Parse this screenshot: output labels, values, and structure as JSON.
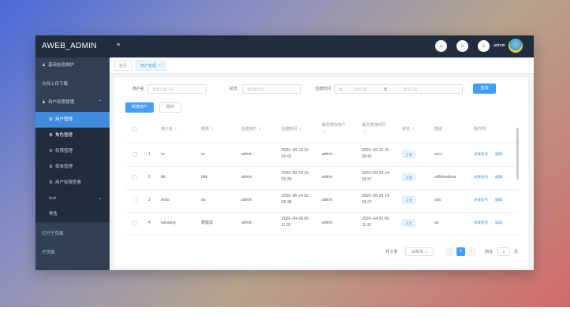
{
  "app": {
    "title": "AWEB_ADMIN",
    "menu_toggle": "≡",
    "user": "admin"
  },
  "colors": {
    "topbar": "#1f2d3d",
    "sidebar": "#304156",
    "accent": "#409eff"
  },
  "topbar_icons": [
    "home-icon",
    "home-icon",
    "home-icon"
  ],
  "sidebar": {
    "items": [
      {
        "label": "基础信息维护",
        "icon": "user-icon"
      },
      {
        "label": "文档上传下载"
      },
      {
        "label": "用户权限管理",
        "icon": "user-icon",
        "arrow": "⌃"
      },
      {
        "label": "用户管理",
        "icon": "gear-icon"
      },
      {
        "label": "角色管理",
        "icon": "gear-icon"
      },
      {
        "label": "权限管理",
        "icon": "gear-icon"
      },
      {
        "label": "菜单管理",
        "icon": "gear-icon"
      },
      {
        "label": "用户权限查看",
        "icon": "gear-icon"
      },
      {
        "label": "test",
        "arrow": "⌄"
      },
      {
        "label": "零售"
      },
      {
        "label": "打开子页面"
      },
      {
        "label": "子页面"
      }
    ]
  },
  "tabs": [
    {
      "label": "首页"
    },
    {
      "label": "用户管理",
      "close": "×"
    }
  ],
  "filters": {
    "username_label": "用户名",
    "username_placeholder": "请输入用户名",
    "status_label": "状态",
    "status_placeholder": "请选择状态",
    "created_label": "创建时间",
    "start_placeholder": "开始日期",
    "range_sep": "至",
    "end_placeholder": "结束日期",
    "query_button": "查询"
  },
  "actions": {
    "add_user": "新增用户",
    "delete": "删除"
  },
  "table": {
    "headers": [
      "用户名",
      "昵称",
      "创建用户",
      "创建时间",
      "最近修改用户",
      "最近修改时间",
      "状态",
      "描述",
      "操作列"
    ],
    "sort_icon": "⇕",
    "rows": [
      {
        "index": "1",
        "username": "cc",
        "nickname": "cc",
        "creator": "admin",
        "created": "2020--06-12 15:",
        "created2": "00:42",
        "modifier": "admin",
        "modified": "2020--06-12 15:",
        "modified2": "00:42",
        "status": "正常",
        "desc": "accc"
      },
      {
        "index": "2",
        "username": "bb",
        "nickname": "bbb",
        "creator": "admin",
        "created": "2020--05-29 14:",
        "created2": "50:39",
        "modifier": "admin",
        "modified": "2020--05-29 14:",
        "modified2": "53:37",
        "status": "正常",
        "desc": "adfrdvadsva"
      },
      {
        "index": "3",
        "username": "testa",
        "nickname": "aa",
        "creator": "admin",
        "created": "2020--05-14 16:",
        "created2": "28:38",
        "modifier": "admin",
        "modified": "2020--05-29 14:",
        "modified2": "53:27",
        "status": "正常",
        "desc": "ssa"
      },
      {
        "index": "4",
        "username": "luisuang",
        "nickname": "黎健成",
        "creator": "admin",
        "created": "2020--04-26 06:",
        "created2": "11:31",
        "modifier": "admin",
        "modified": "2020--04-26 06:",
        "modified2": "11:31",
        "status": "正常",
        "desc": "aa"
      }
    ],
    "row_action_1": "关联角色",
    "row_action_2": "编辑"
  },
  "pagination": {
    "total": "共 9 条",
    "page_size": "10条/页",
    "page_size_arrow": "⌄",
    "prev": "‹",
    "current": "1",
    "next": "›",
    "goto_label": "前往",
    "goto_value": "1",
    "page_unit": "页"
  }
}
